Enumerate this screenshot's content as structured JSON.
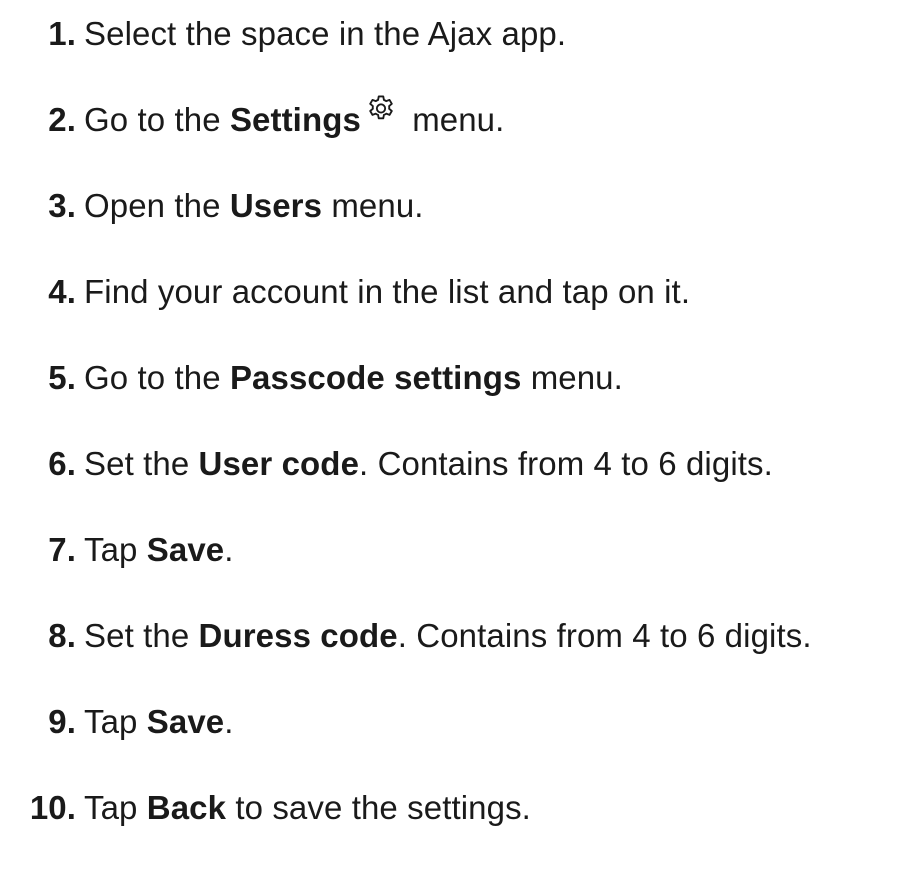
{
  "steps": [
    {
      "num": "1.",
      "parts": [
        {
          "text": "Select the space in the Ajax app.",
          "bold": false
        }
      ]
    },
    {
      "num": "2.",
      "parts": [
        {
          "text": "Go to the ",
          "bold": false
        },
        {
          "text": "Settings",
          "bold": true
        },
        {
          "icon": "gear-icon"
        },
        {
          "text": " menu.",
          "bold": false
        }
      ]
    },
    {
      "num": "3.",
      "parts": [
        {
          "text": "Open the ",
          "bold": false
        },
        {
          "text": "Users",
          "bold": true
        },
        {
          "text": " menu.",
          "bold": false
        }
      ]
    },
    {
      "num": "4.",
      "parts": [
        {
          "text": "Find your account in the list and tap on it.",
          "bold": false
        }
      ]
    },
    {
      "num": "5.",
      "parts": [
        {
          "text": "Go to the ",
          "bold": false
        },
        {
          "text": "Passcode settings",
          "bold": true
        },
        {
          "text": " menu.",
          "bold": false
        }
      ]
    },
    {
      "num": "6.",
      "parts": [
        {
          "text": "Set the ",
          "bold": false
        },
        {
          "text": "User code",
          "bold": true
        },
        {
          "text": ". Contains from 4 to 6 digits.",
          "bold": false
        }
      ]
    },
    {
      "num": "7.",
      "parts": [
        {
          "text": "Tap ",
          "bold": false
        },
        {
          "text": "Save",
          "bold": true
        },
        {
          "text": ".",
          "bold": false
        }
      ]
    },
    {
      "num": "8.",
      "parts": [
        {
          "text": "Set the ",
          "bold": false
        },
        {
          "text": "Duress code",
          "bold": true
        },
        {
          "text": ". Contains from 4 to 6 digits.",
          "bold": false
        }
      ]
    },
    {
      "num": "9.",
      "parts": [
        {
          "text": "Tap ",
          "bold": false
        },
        {
          "text": "Save",
          "bold": true
        },
        {
          "text": ".",
          "bold": false
        }
      ]
    },
    {
      "num": "10.",
      "parts": [
        {
          "text": "Tap ",
          "bold": false
        },
        {
          "text": "Back",
          "bold": true
        },
        {
          "text": " to save the settings.",
          "bold": false
        }
      ]
    }
  ]
}
